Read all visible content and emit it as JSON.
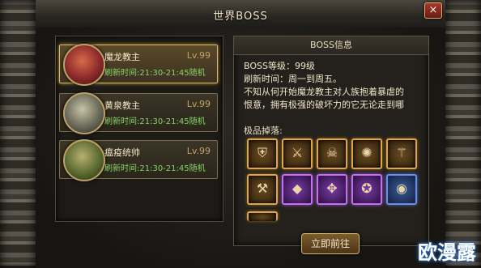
{
  "window": {
    "title": "世界BOSS",
    "close_label": "×"
  },
  "boss_list": [
    {
      "name": "魔龙教主",
      "level": "Lv.99",
      "time": "刷新时间:21:30-21:45随机",
      "selected": true,
      "avatar_color": "#8a2a2a"
    },
    {
      "name": "黄泉教主",
      "level": "Lv.99",
      "time": "刷新时间:21:30-21:45随机",
      "selected": false,
      "avatar_color": "#6a6a58"
    },
    {
      "name": "瘟疫统帅",
      "level": "Lv.99",
      "time": "刷新时间:21:30-21:45随机",
      "selected": false,
      "avatar_color": "#5a6a30"
    }
  ],
  "info": {
    "header": "BOSS信息",
    "level_line": "BOSS等级：99级",
    "refresh_line": "刷新时间：周一到周五。",
    "desc_line1": "不知从何开始魔龙教主对人族抱着暴虐的",
    "desc_line2": "恨意，拥有极强的破坏力的它无论走到哪",
    "drops_label": "极品掉落:"
  },
  "drops": [
    {
      "icon": "armor-icon",
      "rarity": "orange"
    },
    {
      "icon": "sword-icon",
      "rarity": "orange"
    },
    {
      "icon": "skull-icon",
      "rarity": "orange"
    },
    {
      "icon": "gear-icon",
      "rarity": "orange"
    },
    {
      "icon": "blade-icon",
      "rarity": "orange"
    },
    {
      "icon": "staff-icon",
      "rarity": "orange"
    },
    {
      "icon": "gem-icon",
      "rarity": "purple"
    },
    {
      "icon": "chain-icon",
      "rarity": "purple"
    },
    {
      "icon": "coin-icon",
      "rarity": "purple"
    },
    {
      "icon": "shield-icon",
      "rarity": "blue"
    },
    {
      "icon": "item-icon",
      "rarity": "orange"
    }
  ],
  "actions": {
    "go_label": "立即前往"
  },
  "watermark": "欧漫露"
}
